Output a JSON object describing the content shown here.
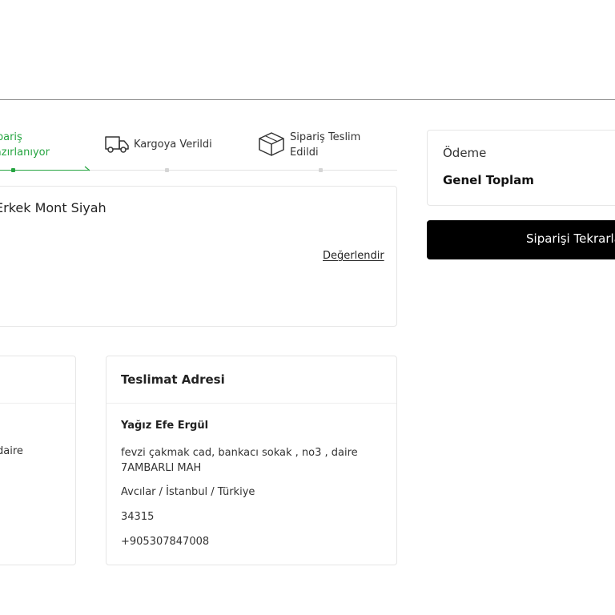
{
  "stepper": {
    "steps": [
      {
        "label": "Sipariş\nHazırlanıyor",
        "state": "active"
      },
      {
        "label": "Kargoya Verildi",
        "state": "pending",
        "icon": "truck-icon"
      },
      {
        "label": "Sipariş Teslim\nEdildi",
        "state": "pending",
        "icon": "box-icon"
      }
    ],
    "active_color": "#26a541"
  },
  "product": {
    "name": "Erkek Mont Siyah",
    "rate_label": "Değerlendir"
  },
  "billing_address": {
    "partial_text": "daire"
  },
  "delivery_address": {
    "title": "Teslimat Adresi",
    "recipient": "Yağız Efe Ergül",
    "address": "fevzi çakmak cad, bankacı sokak , no3 , daire 7AMBARLI MAH",
    "city": "Avcılar / İstanbul / Türkiye",
    "postal_code": "34315",
    "phone": "+905307847008"
  },
  "payment": {
    "title": "Ödeme",
    "total_label": "Genel Toplam"
  },
  "actions": {
    "reorder_label": "Siparişi Tekrarla"
  }
}
